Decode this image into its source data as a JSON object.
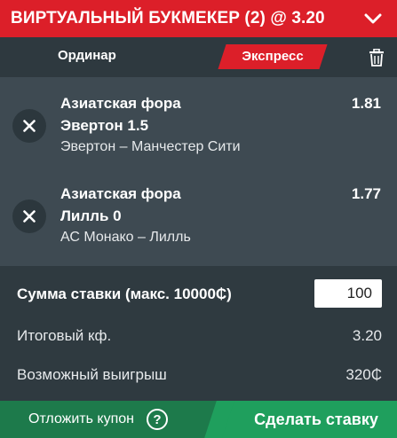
{
  "header": {
    "title": "ВИРТУАЛЬНЫЙ БУКМЕКЕР (2) @ 3.20",
    "icon": "chevron-down-icon"
  },
  "tabs": {
    "single": "Ординар",
    "express": "Экспресс",
    "active": "express",
    "clear_icon": "trash-icon"
  },
  "bets": [
    {
      "market": "Азиатская фора",
      "selection": "Эвертон 1.5",
      "event": "Эвертон – Манчестер Сити",
      "odds": "1.81"
    },
    {
      "market": "Азиатская фора",
      "selection": "Лилль 0",
      "event": "АС Монако – Лилль",
      "odds": "1.77"
    }
  ],
  "totals": {
    "stake_label": "Сумма ставки (макс. 10000₵)",
    "stake_value": "100",
    "total_odds_label": "Итоговый кф.",
    "total_odds_value": "3.20",
    "payout_label": "Возможный выигрыш",
    "payout_value": "320₵"
  },
  "footer": {
    "save_coupon": "Отложить купон",
    "help": "?",
    "place_bet": "Сделать ставку"
  },
  "colors": {
    "accent_red": "#dc1f29",
    "panel": "#3e4a52",
    "dark_panel": "#2f3a40",
    "green": "#1f9f5d",
    "dark_green": "#1d7a4b"
  }
}
